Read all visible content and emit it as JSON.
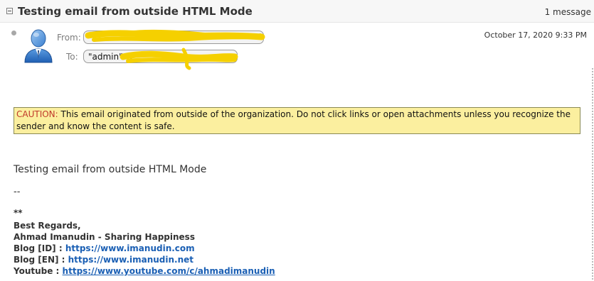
{
  "thread": {
    "subject": "Testing email from outside HTML Mode",
    "message_count": "1 message"
  },
  "message": {
    "from_label": "From:",
    "to_label": "To:",
    "from_value": "\"",
    "to_value": "\"admin\" <",
    "date": "October 17, 2020 9:33 PM"
  },
  "caution": {
    "prefix": "CAUTION:",
    "text": " This email originated from outside of the organization. Do not click links or open attachments unless you recognize the sender and know the content is safe."
  },
  "body": {
    "main": "Testing email from outside HTML Mode",
    "dashes": "--",
    "stars": "**",
    "signature": {
      "regards": "Best Regards,",
      "name_line": "Ahmad Imanudin -  Sharing Happiness",
      "blog_id_label": "Blog [ID] : ",
      "blog_id_link": "https://www.imanudin.com",
      "blog_en_label": "Blog [EN] : ",
      "blog_en_link": "https://www.imanudin.net",
      "youtube_label": "Youtube : ",
      "youtube_link": "https://www.youtube.com/c/ahmadimanudin"
    }
  },
  "colors": {
    "caution_bg": "#fbef9f",
    "caution_prefix": "#c0392b",
    "link": "#1a5fb4",
    "redaction": "#f5d000"
  },
  "icons": {
    "collapse": "collapse-minus-icon",
    "avatar": "contact-avatar-icon",
    "bullet": "unread-bullet-icon"
  }
}
